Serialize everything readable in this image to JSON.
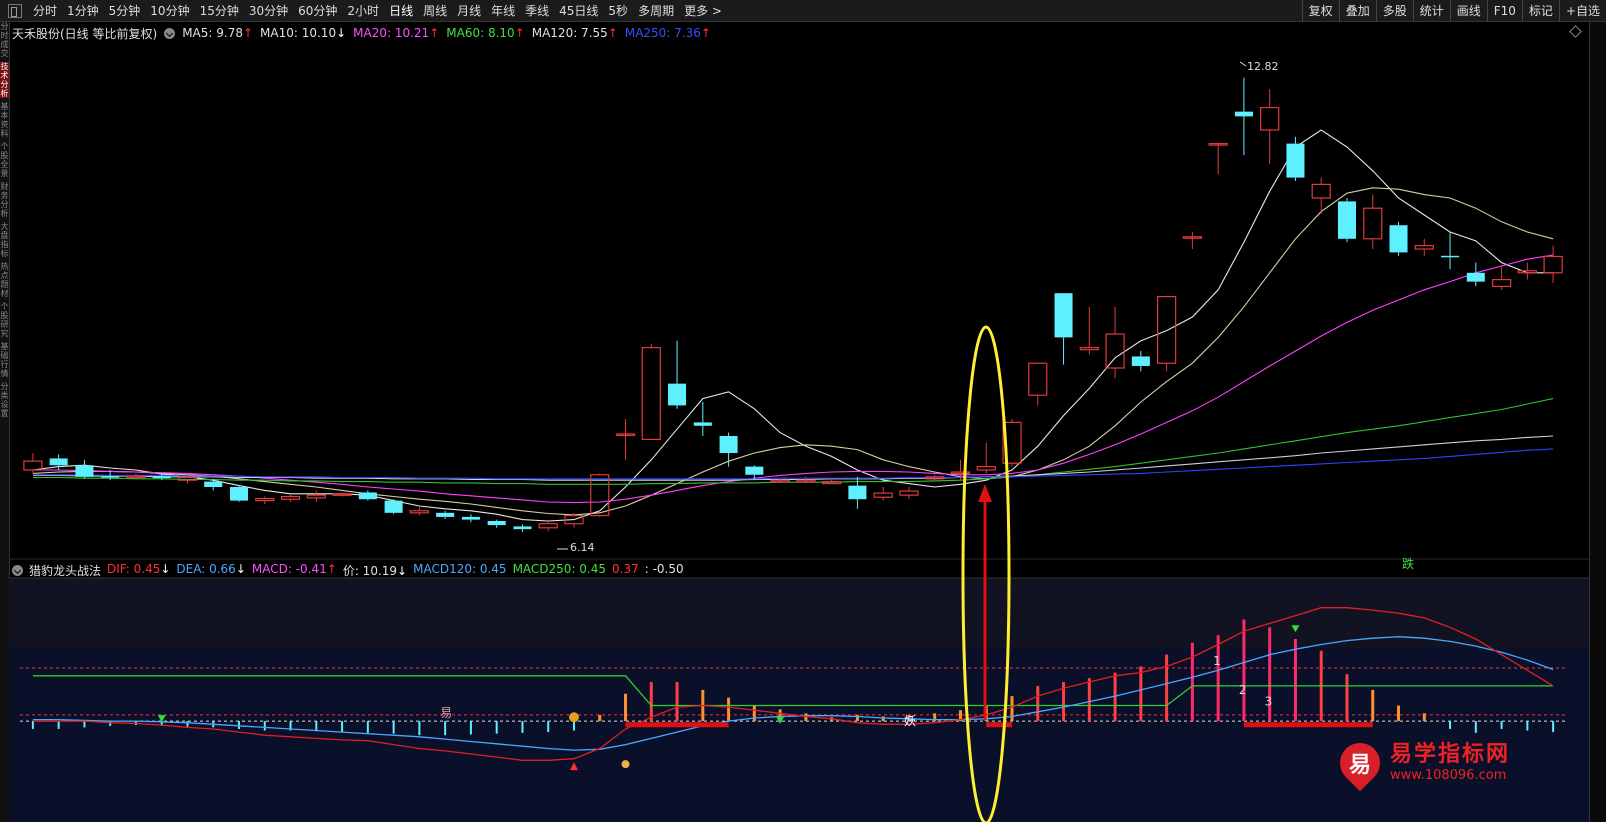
{
  "toolbar": {
    "periods": [
      "分时",
      "1分钟",
      "5分钟",
      "10分钟",
      "15分钟",
      "30分钟",
      "60分钟",
      "2小时",
      "日线",
      "周线",
      "月线",
      "年线",
      "季线",
      "45日线",
      "5秒",
      "多周期",
      "更多 >"
    ],
    "tools": [
      "复权",
      "叠加",
      "多股",
      "统计",
      "画线",
      "F10",
      "标记",
      "+自选"
    ]
  },
  "side_tabs": [
    "分时成交",
    "技术分析",
    "基本资料",
    "个股全景",
    "财务分析",
    "大盘指标",
    "热点题材",
    "个股研究",
    "基础行情",
    "分类设置"
  ],
  "main_legend": {
    "stock": "天禾股份(日线 等比前复权)",
    "ma": [
      {
        "label": "MA5: 9.78",
        "arrow": "↑",
        "color": "#e0e0e0",
        "arrow_color": "#ff3030"
      },
      {
        "label": "MA10: 10.10",
        "arrow": "↓",
        "color": "#e0e0e0",
        "arrow_color": "#ffffff"
      },
      {
        "label": "MA20: 10.21",
        "arrow": "↑",
        "color": "#ff50ff",
        "arrow_color": "#ff3030"
      },
      {
        "label": "MA60: 8.10",
        "arrow": "↑",
        "color": "#40e040",
        "arrow_color": "#ff3030"
      },
      {
        "label": "MA120: 7.55",
        "arrow": "↑",
        "color": "#e0e0e0",
        "arrow_color": "#ff3030"
      },
      {
        "label": "MA250: 7.36",
        "arrow": "↑",
        "color": "#3050ff",
        "arrow_color": "#ff3030"
      }
    ],
    "high_label": "12.82",
    "low_label": "6.14",
    "fall_label": "跌"
  },
  "indicator_legend": {
    "name": "猎豹龙头战法",
    "items": [
      {
        "label": "DIF: 0.45",
        "arrow": "↓",
        "color": "#ff3030",
        "arrow_color": "#ffffff"
      },
      {
        "label": "DEA: 0.66",
        "arrow": "↓",
        "color": "#4aa8ff",
        "arrow_color": "#ffffff"
      },
      {
        "label": "MACD: -0.41",
        "arrow": "↑",
        "color": "#ff50ff",
        "arrow_color": "#ff3030"
      },
      {
        "label": "价: 10.19",
        "arrow": "↓",
        "color": "#e0e0e0",
        "arrow_color": "#ffffff"
      },
      {
        "label": "MACD120: 0.45",
        "arrow": "",
        "color": "#4aa8ff",
        "arrow_color": ""
      },
      {
        "label": "MACD250: 0.45",
        "arrow": "",
        "color": "#40e040",
        "arrow_color": ""
      },
      {
        "label": "0.37",
        "arrow": "",
        "color": "#ff3030",
        "arrow_color": ""
      },
      {
        "label": ": -0.50",
        "arrow": "",
        "color": "#e0e0e0",
        "arrow_color": ""
      }
    ],
    "marks": [
      "易",
      "妖",
      "1",
      "2",
      "3"
    ]
  },
  "watermark": {
    "name": "易学指标网",
    "url": "www.108096.com",
    "icon": "易"
  },
  "colors": {
    "up": "#e03a3a",
    "down": "#5ef0ff",
    "highlight": "#ffee33",
    "arrow": "#e01010"
  },
  "chart_data": {
    "type": "candlestick",
    "candles": [
      [
        7.05,
        7.18,
        7.3,
        7.0
      ],
      [
        7.22,
        7.12,
        7.28,
        7.05
      ],
      [
        7.12,
        6.95,
        7.2,
        6.92
      ],
      [
        6.96,
        6.95,
        7.05,
        6.9
      ],
      [
        6.95,
        6.96,
        7.0,
        6.92
      ],
      [
        6.96,
        6.93,
        7.0,
        6.9
      ],
      [
        6.9,
        6.94,
        7.0,
        6.85
      ],
      [
        6.88,
        6.8,
        6.92,
        6.75
      ],
      [
        6.8,
        6.6,
        6.82,
        6.58
      ],
      [
        6.6,
        6.63,
        6.66,
        6.55
      ],
      [
        6.62,
        6.66,
        6.7,
        6.58
      ],
      [
        6.64,
        6.68,
        6.75,
        6.58
      ],
      [
        6.7,
        6.7,
        6.72,
        6.66
      ],
      [
        6.72,
        6.62,
        6.75,
        6.6
      ],
      [
        6.6,
        6.42,
        6.62,
        6.4
      ],
      [
        6.42,
        6.45,
        6.5,
        6.38
      ],
      [
        6.42,
        6.36,
        6.45,
        6.33
      ],
      [
        6.36,
        6.32,
        6.4,
        6.28
      ],
      [
        6.3,
        6.24,
        6.32,
        6.2
      ],
      [
        6.22,
        6.18,
        6.25,
        6.14
      ],
      [
        6.2,
        6.26,
        6.3,
        6.15
      ],
      [
        6.26,
        6.38,
        6.42,
        6.2
      ],
      [
        6.38,
        6.98,
        7.0,
        6.36
      ],
      [
        7.58,
        7.58,
        7.8,
        7.2
      ],
      [
        7.5,
        8.85,
        8.9,
        7.5
      ],
      [
        8.32,
        8.0,
        8.95,
        7.95
      ],
      [
        7.75,
        7.7,
        8.05,
        7.55
      ],
      [
        7.55,
        7.3,
        7.6,
        7.1
      ],
      [
        7.1,
        6.98,
        7.12,
        6.9
      ],
      [
        6.9,
        6.9,
        6.92,
        6.85
      ],
      [
        6.9,
        6.9,
        6.95,
        6.85
      ],
      [
        6.85,
        6.88,
        6.92,
        6.85
      ],
      [
        6.82,
        6.62,
        6.95,
        6.48
      ],
      [
        6.65,
        6.71,
        6.8,
        6.6
      ],
      [
        6.68,
        6.74,
        6.8,
        6.62
      ],
      [
        6.92,
        6.95,
        6.98,
        6.88
      ],
      [
        7.0,
        7.02,
        7.2,
        6.9
      ],
      [
        7.05,
        7.1,
        7.45,
        7.0
      ],
      [
        7.15,
        7.75,
        7.8,
        7.1
      ],
      [
        8.15,
        8.62,
        8.62,
        8.0
      ],
      [
        9.65,
        9.0,
        9.65,
        8.6
      ],
      [
        8.82,
        8.85,
        9.45,
        8.75
      ],
      [
        8.55,
        9.05,
        9.45,
        8.4
      ],
      [
        8.72,
        8.58,
        8.8,
        8.5
      ],
      [
        8.62,
        9.6,
        9.6,
        8.5
      ],
      [
        10.48,
        10.48,
        10.55,
        10.3
      ],
      [
        11.85,
        11.85,
        11.85,
        11.4
      ],
      [
        12.32,
        12.25,
        12.82,
        11.68
      ],
      [
        12.05,
        12.38,
        12.65,
        11.55
      ],
      [
        11.85,
        11.35,
        11.95,
        11.3
      ],
      [
        11.05,
        11.25,
        11.35,
        10.82
      ],
      [
        11.0,
        10.45,
        11.05,
        10.4
      ],
      [
        10.45,
        10.9,
        11.1,
        10.3
      ],
      [
        10.65,
        10.25,
        10.7,
        10.2
      ],
      [
        10.3,
        10.35,
        10.45,
        10.2
      ],
      [
        10.2,
        10.18,
        10.55,
        10.0
      ],
      [
        9.95,
        9.82,
        10.1,
        9.75
      ],
      [
        9.75,
        9.85,
        10.05,
        9.7
      ],
      [
        9.95,
        9.98,
        10.1,
        9.85
      ],
      [
        9.95,
        10.19,
        10.35,
        9.8
      ]
    ],
    "ma": {
      "MA5": [
        7.05,
        7.1,
        7.12,
        7.08,
        7.05,
        6.99,
        6.95,
        6.9,
        6.82,
        6.75,
        6.7,
        6.7,
        6.7,
        6.68,
        6.6,
        6.52,
        6.48,
        6.45,
        6.4,
        6.32,
        6.3,
        6.32,
        6.45,
        6.8,
        7.2,
        7.65,
        8.1,
        8.2,
        7.95,
        7.6,
        7.4,
        7.25,
        7.05,
        6.9,
        6.85,
        6.8,
        6.84,
        6.9,
        7.05,
        7.4,
        7.85,
        8.25,
        8.7,
        8.95,
        9.1,
        9.3,
        9.7,
        10.4,
        11.15,
        11.8,
        12.05,
        11.8,
        11.45,
        11.05,
        10.8,
        10.55,
        10.42,
        10.1,
        9.95,
        9.95
      ],
      "MA10": [
        7.0,
        7.02,
        7.03,
        7.03,
        7.02,
        7.0,
        6.98,
        6.96,
        6.92,
        6.88,
        6.84,
        6.8,
        6.75,
        6.7,
        6.66,
        6.62,
        6.59,
        6.55,
        6.5,
        6.45,
        6.41,
        6.39,
        6.42,
        6.52,
        6.68,
        6.85,
        7.02,
        7.18,
        7.3,
        7.38,
        7.42,
        7.4,
        7.35,
        7.2,
        7.1,
        7.02,
        6.95,
        6.92,
        6.95,
        7.05,
        7.2,
        7.4,
        7.7,
        8.05,
        8.35,
        8.62,
        9.0,
        9.45,
        9.95,
        10.45,
        10.85,
        11.12,
        11.2,
        11.18,
        11.1,
        11.05,
        10.9,
        10.7,
        10.55,
        10.45
      ],
      "MA20": [
        7.05,
        7.05,
        7.04,
        7.03,
        7.02,
        7.01,
        7.0,
        6.98,
        6.96,
        6.93,
        6.9,
        6.87,
        6.84,
        6.8,
        6.77,
        6.74,
        6.7,
        6.67,
        6.64,
        6.61,
        6.58,
        6.57,
        6.58,
        6.62,
        6.68,
        6.75,
        6.82,
        6.88,
        6.93,
        6.97,
        7.0,
        7.02,
        7.03,
        7.03,
        7.02,
        7.0,
        6.98,
        6.98,
        7.0,
        7.05,
        7.15,
        7.28,
        7.42,
        7.58,
        7.75,
        7.92,
        8.12,
        8.35,
        8.58,
        8.8,
        9.02,
        9.22,
        9.4,
        9.55,
        9.7,
        9.82,
        9.95,
        10.05,
        10.15,
        10.21
      ],
      "MA60": [
        6.94,
        6.94,
        6.93,
        6.93,
        6.92,
        6.92,
        6.91,
        6.91,
        6.9,
        6.9,
        6.89,
        6.89,
        6.88,
        6.88,
        6.87,
        6.87,
        6.86,
        6.86,
        6.85,
        6.85,
        6.84,
        6.84,
        6.84,
        6.84,
        6.85,
        6.85,
        6.86,
        6.86,
        6.86,
        6.87,
        6.87,
        6.87,
        6.88,
        6.88,
        6.88,
        6.89,
        6.9,
        6.92,
        6.95,
        6.98,
        7.02,
        7.06,
        7.1,
        7.15,
        7.2,
        7.25,
        7.3,
        7.36,
        7.42,
        7.48,
        7.54,
        7.6,
        7.65,
        7.7,
        7.76,
        7.82,
        7.88,
        7.94,
        8.02,
        8.1
      ],
      "MA120": [
        6.97,
        6.97,
        6.96,
        6.96,
        6.96,
        6.95,
        6.95,
        6.95,
        6.94,
        6.94,
        6.94,
        6.93,
        6.93,
        6.93,
        6.92,
        6.92,
        6.92,
        6.91,
        6.91,
        6.91,
        6.9,
        6.9,
        6.9,
        6.9,
        6.9,
        6.9,
        6.9,
        6.9,
        6.91,
        6.91,
        6.91,
        6.92,
        6.92,
        6.92,
        6.93,
        6.93,
        6.94,
        6.95,
        6.96,
        6.98,
        7.0,
        7.02,
        7.05,
        7.08,
        7.11,
        7.14,
        7.17,
        7.2,
        7.23,
        7.26,
        7.3,
        7.33,
        7.36,
        7.39,
        7.42,
        7.45,
        7.48,
        7.5,
        7.53,
        7.55
      ],
      "MA250": [
        6.98,
        6.98,
        6.98,
        6.97,
        6.97,
        6.97,
        6.96,
        6.96,
        6.96,
        6.95,
        6.95,
        6.95,
        6.94,
        6.94,
        6.94,
        6.93,
        6.93,
        6.93,
        6.92,
        6.92,
        6.92,
        6.92,
        6.92,
        6.92,
        6.92,
        6.92,
        6.92,
        6.92,
        6.92,
        6.93,
        6.93,
        6.93,
        6.93,
        6.93,
        6.94,
        6.94,
        6.94,
        6.95,
        6.95,
        6.96,
        6.97,
        6.98,
        6.99,
        7.0,
        7.02,
        7.04,
        7.06,
        7.08,
        7.1,
        7.12,
        7.14,
        7.16,
        7.18,
        7.2,
        7.22,
        7.25,
        7.28,
        7.31,
        7.34,
        7.36
      ]
    },
    "indicator": {
      "ylim": [
        -1.2,
        1.6
      ],
      "dif": [
        0.0,
        0.0,
        0.0,
        -0.02,
        -0.03,
        -0.05,
        -0.08,
        -0.1,
        -0.14,
        -0.18,
        -0.2,
        -0.22,
        -0.24,
        -0.25,
        -0.3,
        -0.35,
        -0.38,
        -0.42,
        -0.46,
        -0.5,
        -0.5,
        -0.48,
        -0.35,
        -0.1,
        0.05,
        0.18,
        0.2,
        0.18,
        0.14,
        0.1,
        0.06,
        0.03,
        -0.02,
        -0.04,
        -0.04,
        -0.02,
        0.02,
        0.08,
        0.18,
        0.32,
        0.42,
        0.5,
        0.58,
        0.62,
        0.7,
        0.82,
        0.98,
        1.15,
        1.25,
        1.35,
        1.45,
        1.45,
        1.42,
        1.38,
        1.32,
        1.2,
        1.05,
        0.85,
        0.65,
        0.45
      ],
      "dea": [
        0.02,
        0.02,
        0.01,
        0.0,
        0.0,
        -0.01,
        -0.02,
        -0.04,
        -0.06,
        -0.08,
        -0.1,
        -0.12,
        -0.14,
        -0.16,
        -0.18,
        -0.2,
        -0.23,
        -0.26,
        -0.29,
        -0.32,
        -0.35,
        -0.37,
        -0.36,
        -0.3,
        -0.22,
        -0.14,
        -0.06,
        0.0,
        0.04,
        0.06,
        0.07,
        0.07,
        0.06,
        0.04,
        0.03,
        0.02,
        0.02,
        0.03,
        0.06,
        0.12,
        0.18,
        0.25,
        0.32,
        0.4,
        0.48,
        0.56,
        0.65,
        0.75,
        0.85,
        0.92,
        0.98,
        1.03,
        1.06,
        1.08,
        1.06,
        1.02,
        0.96,
        0.88,
        0.78,
        0.66
      ],
      "green_level": [
        0.58,
        0.58,
        0.58,
        0.58,
        0.58,
        0.58,
        0.58,
        0.58,
        0.58,
        0.58,
        0.58,
        0.58,
        0.58,
        0.58,
        0.58,
        0.58,
        0.58,
        0.58,
        0.58,
        0.58,
        0.58,
        0.58,
        0.58,
        0.58,
        0.2,
        0.2,
        0.2,
        0.2,
        0.2,
        0.2,
        0.2,
        0.2,
        0.2,
        0.2,
        0.2,
        0.2,
        0.2,
        0.2,
        0.2,
        0.2,
        0.2,
        0.2,
        0.2,
        0.2,
        0.2,
        0.45,
        0.45,
        0.45,
        0.45,
        0.45,
        0.45,
        0.45,
        0.45,
        0.45,
        0.45,
        0.45,
        0.45,
        0.45,
        0.45,
        0.45
      ],
      "bars": [
        -0.1,
        -0.1,
        -0.08,
        -0.06,
        -0.05,
        -0.06,
        -0.07,
        -0.08,
        -0.1,
        -0.12,
        -0.12,
        -0.13,
        -0.14,
        -0.15,
        -0.16,
        -0.18,
        -0.18,
        -0.17,
        -0.16,
        -0.15,
        -0.14,
        -0.12,
        0.08,
        0.35,
        0.5,
        0.5,
        0.4,
        0.3,
        0.2,
        0.15,
        0.1,
        0.05,
        0.08,
        0.06,
        0.08,
        0.1,
        0.14,
        0.2,
        0.32,
        0.45,
        0.5,
        0.55,
        0.62,
        0.7,
        0.85,
        1.0,
        1.1,
        1.3,
        1.2,
        1.05,
        0.9,
        0.6,
        0.4,
        0.2,
        0.1,
        -0.1,
        -0.15,
        -0.1,
        -0.12,
        -0.14
      ]
    }
  }
}
